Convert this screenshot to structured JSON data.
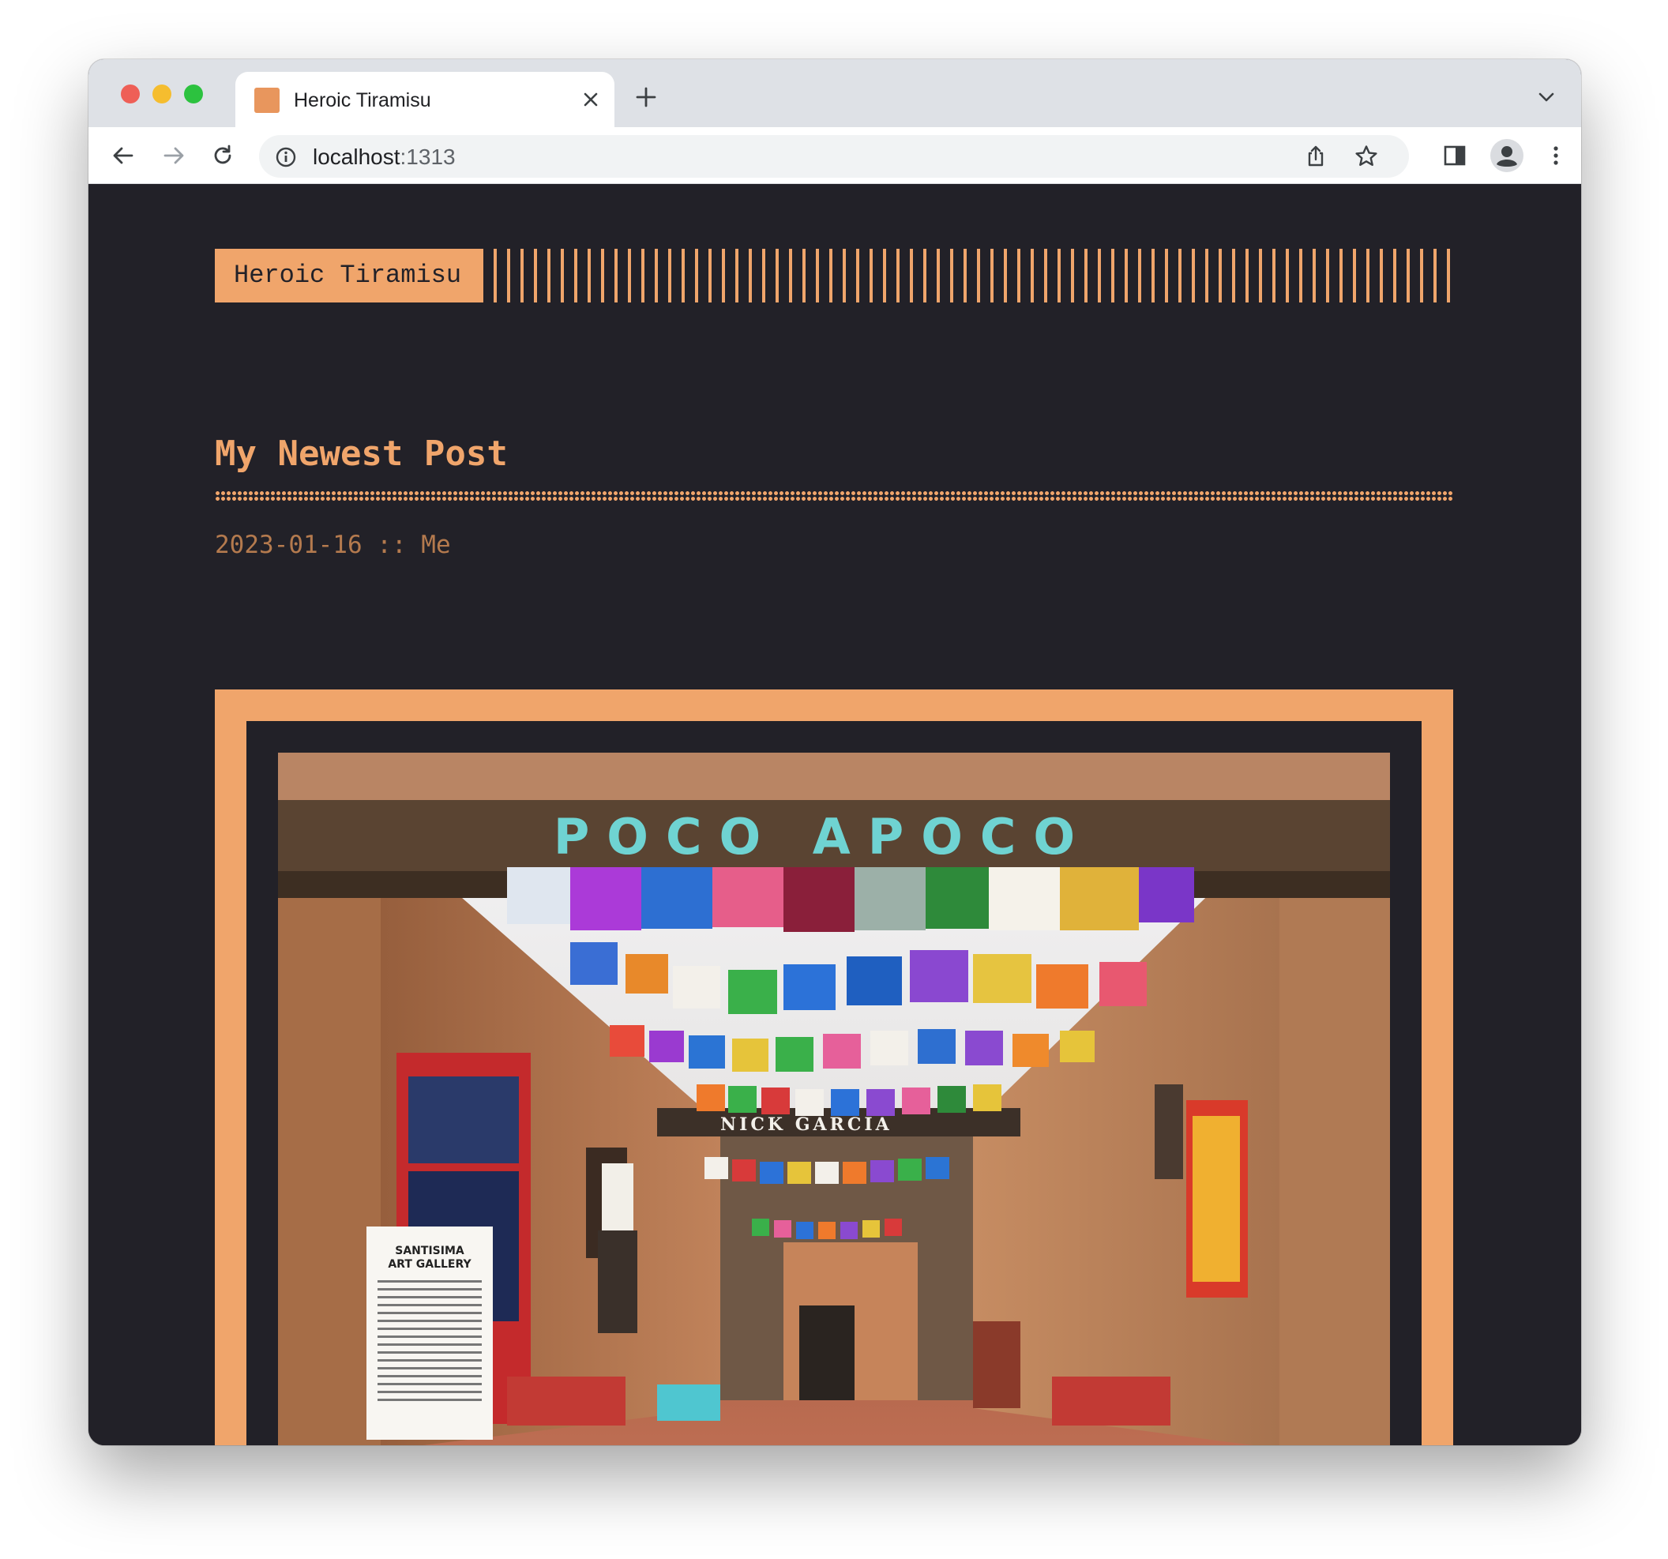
{
  "browser": {
    "tab_title": "Heroic Tiramisu",
    "url_host": "localhost",
    "url_port": ":1313",
    "icons": [
      "close-icon",
      "plus-icon",
      "chevron-down-icon",
      "back-arrow-icon",
      "forward-arrow-icon",
      "reload-icon",
      "info-icon",
      "share-icon",
      "star-icon",
      "sidebar-icon",
      "profile-icon",
      "more-vert-icon"
    ]
  },
  "site": {
    "logo": "Heroic Tiramisu"
  },
  "post": {
    "title": "My Newest Post",
    "meta": "2023-01-16 :: Me",
    "image": {
      "sign_text": "POCO APOCO",
      "gallery_sign_title": "SANTISIMA\nART GALLERY",
      "street_sign": "NICK GARCIA"
    }
  },
  "colors": {
    "accent": "#f0a56b",
    "background": "#222128",
    "meta": "#b47a4e"
  }
}
